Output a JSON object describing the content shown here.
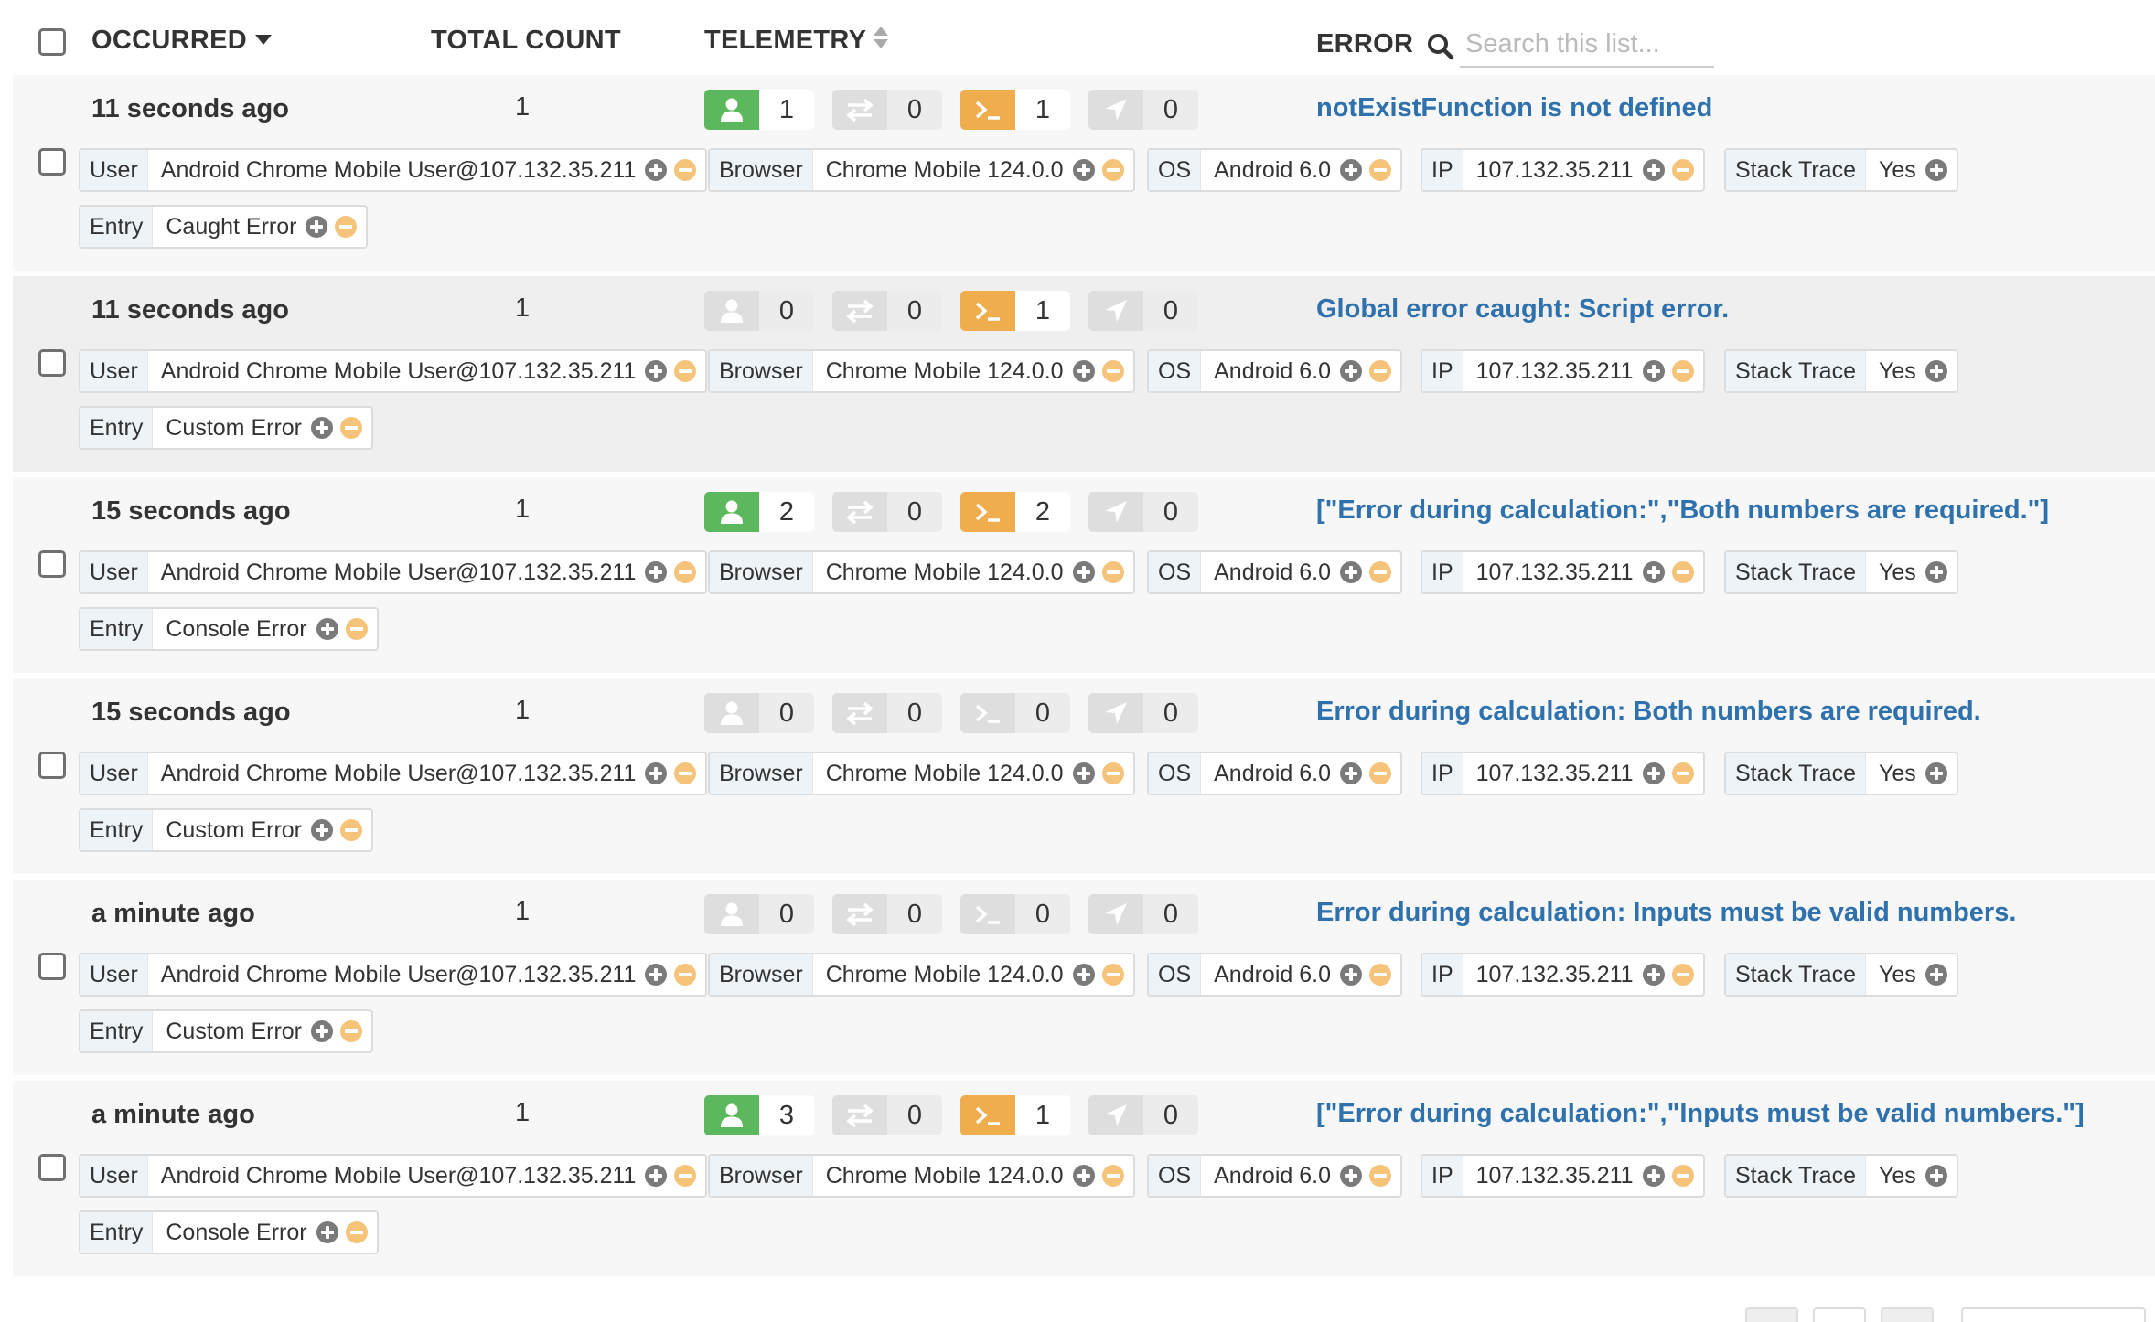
{
  "header": {
    "occurred": "OCCURRED",
    "total_count": "TOTAL COUNT",
    "telemetry": "TELEMETRY",
    "error": "ERROR",
    "search_placeholder": "Search this list..."
  },
  "icons": {
    "user": "user-icon",
    "network": "arrows-exchange-icon",
    "console": "terminal-icon",
    "navigation": "location-arrow-icon",
    "search": "search-icon",
    "add": "plus-circle-icon",
    "remove": "minus-circle-icon"
  },
  "colors": {
    "user_active": "#5cb85c",
    "console_active": "#f0ad4e",
    "inactive": "#dedede",
    "error_link": "#2f71ad",
    "row_bg": "#f7f7f7",
    "row_bg_highlight": "#efefef"
  },
  "rows": [
    {
      "occurred": "11 seconds ago",
      "count": "1",
      "telemetry": {
        "user": "1",
        "network": "0",
        "console": "1",
        "navigation": "0"
      },
      "error": "notExistFunction is not defined",
      "tags": {
        "user_key": "User",
        "user_val": "Android Chrome Mobile User@107.132.35.211",
        "browser_key": "Browser",
        "browser_val": "Chrome Mobile 124.0.0",
        "os_key": "OS",
        "os_val": "Android 6.0",
        "ip_key": "IP",
        "ip_val": "107.132.35.211",
        "stack_key": "Stack Trace",
        "stack_val": "Yes",
        "entry_key": "Entry",
        "entry_val": "Caught Error"
      }
    },
    {
      "occurred": "11 seconds ago",
      "count": "1",
      "telemetry": {
        "user": "0",
        "network": "0",
        "console": "1",
        "navigation": "0"
      },
      "error": "Global error caught: Script error.",
      "tags": {
        "user_key": "User",
        "user_val": "Android Chrome Mobile User@107.132.35.211",
        "browser_key": "Browser",
        "browser_val": "Chrome Mobile 124.0.0",
        "os_key": "OS",
        "os_val": "Android 6.0",
        "ip_key": "IP",
        "ip_val": "107.132.35.211",
        "stack_key": "Stack Trace",
        "stack_val": "Yes",
        "entry_key": "Entry",
        "entry_val": "Custom Error"
      }
    },
    {
      "occurred": "15 seconds ago",
      "count": "1",
      "telemetry": {
        "user": "2",
        "network": "0",
        "console": "2",
        "navigation": "0"
      },
      "error": "[\"Error during calculation:\",\"Both numbers are required.\"]",
      "tags": {
        "user_key": "User",
        "user_val": "Android Chrome Mobile User@107.132.35.211",
        "browser_key": "Browser",
        "browser_val": "Chrome Mobile 124.0.0",
        "os_key": "OS",
        "os_val": "Android 6.0",
        "ip_key": "IP",
        "ip_val": "107.132.35.211",
        "stack_key": "Stack Trace",
        "stack_val": "Yes",
        "entry_key": "Entry",
        "entry_val": "Console Error"
      }
    },
    {
      "occurred": "15 seconds ago",
      "count": "1",
      "telemetry": {
        "user": "0",
        "network": "0",
        "console": "0",
        "navigation": "0"
      },
      "error": "Error during calculation: Both numbers are required.",
      "tags": {
        "user_key": "User",
        "user_val": "Android Chrome Mobile User@107.132.35.211",
        "browser_key": "Browser",
        "browser_val": "Chrome Mobile 124.0.0",
        "os_key": "OS",
        "os_val": "Android 6.0",
        "ip_key": "IP",
        "ip_val": "107.132.35.211",
        "stack_key": "Stack Trace",
        "stack_val": "Yes",
        "entry_key": "Entry",
        "entry_val": "Custom Error"
      }
    },
    {
      "occurred": "a minute ago",
      "count": "1",
      "telemetry": {
        "user": "0",
        "network": "0",
        "console": "0",
        "navigation": "0"
      },
      "error": "Error during calculation: Inputs must be valid numbers.",
      "tags": {
        "user_key": "User",
        "user_val": "Android Chrome Mobile User@107.132.35.211",
        "browser_key": "Browser",
        "browser_val": "Chrome Mobile 124.0.0",
        "os_key": "OS",
        "os_val": "Android 6.0",
        "ip_key": "IP",
        "ip_val": "107.132.35.211",
        "stack_key": "Stack Trace",
        "stack_val": "Yes",
        "entry_key": "Entry",
        "entry_val": "Custom Error"
      }
    },
    {
      "occurred": "a minute ago",
      "count": "1",
      "telemetry": {
        "user": "3",
        "network": "0",
        "console": "1",
        "navigation": "0"
      },
      "error": "[\"Error during calculation:\",\"Inputs must be valid numbers.\"]",
      "tags": {
        "user_key": "User",
        "user_val": "Android Chrome Mobile User@107.132.35.211",
        "browser_key": "Browser",
        "browser_val": "Chrome Mobile 124.0.0",
        "os_key": "OS",
        "os_val": "Android 6.0",
        "ip_key": "IP",
        "ip_val": "107.132.35.211",
        "stack_key": "Stack Trace",
        "stack_val": "Yes",
        "entry_key": "Entry",
        "entry_val": "Console Error"
      }
    }
  ]
}
